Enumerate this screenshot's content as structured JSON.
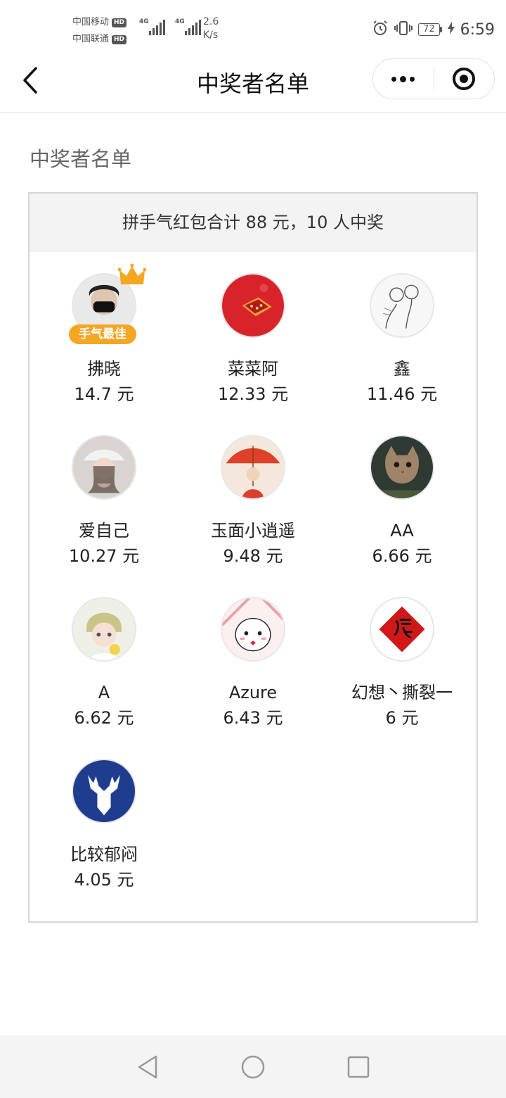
{
  "status_bar": {
    "carrier1": "中国移动",
    "carrier2": "中国联通",
    "hd_label": "HD",
    "network_type": "4G",
    "net_speed_value": "2.6",
    "net_speed_unit": "K/s",
    "battery_level": "72",
    "time": "6:59"
  },
  "nav": {
    "title": "中奖者名单",
    "back_icon": "chevron-left-icon",
    "more_icon": "more-dots-icon",
    "close_icon": "target-circle-icon"
  },
  "section_title": "中奖者名单",
  "summary": "拼手气红包合计 88 元，10 人中奖",
  "best_luck_label": "手气最佳",
  "winners": [
    {
      "name": "拂晓",
      "amount": "14.7 元",
      "best": true
    },
    {
      "name": "菜菜阿",
      "amount": "12.33 元"
    },
    {
      "name": "鑫",
      "amount": "11.46 元"
    },
    {
      "name": "爱自己",
      "amount": "10.27 元"
    },
    {
      "name": "玉面小逍遥",
      "amount": "9.48 元"
    },
    {
      "name": "AA",
      "amount": "6.66 元"
    },
    {
      "name": "A",
      "amount": "6.62 元"
    },
    {
      "name": "Azure",
      "amount": "6.43 元"
    },
    {
      "name": "幻想丶撕裂一",
      "amount": "6 元"
    },
    {
      "name": "比较郁闷",
      "amount": "4.05 元"
    }
  ],
  "colors": {
    "best_badge": "#f5a623",
    "panel_header_bg": "#f3f3f3",
    "text_primary": "#222222"
  },
  "system_nav": {
    "back_icon": "triangle-back-icon",
    "home_icon": "circle-home-icon",
    "recents_icon": "square-recents-icon"
  }
}
